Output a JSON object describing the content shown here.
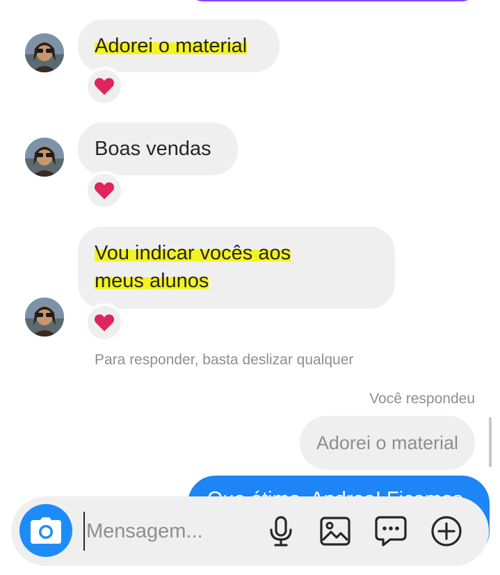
{
  "messages": [
    {
      "text": "Adorei o material",
      "reaction": "heart-icon"
    },
    {
      "text": "Boas vendas",
      "reaction": "heart-icon"
    },
    {
      "text_line1": "Vou indicar vocês aos",
      "text_line2": "meus alunos",
      "reaction": "heart-icon"
    }
  ],
  "hint": "Para responder, basta deslizar qualquer",
  "reply_label": "Você respondeu",
  "reply_quote": "Adorei o material",
  "outgoing_partial": "Que ótimo, Andrea! Ficamos",
  "composer": {
    "placeholder": "Mensagem...",
    "icons": [
      "camera-icon",
      "microphone-icon",
      "gallery-icon",
      "sticker-chat-icon",
      "add-icon"
    ]
  },
  "colors": {
    "highlight": "#f3f321",
    "outgoing_bubble": "#1d85f5",
    "camera_button": "#1d8cf8",
    "top_bubble": "#8a3ffc",
    "reaction_heart": "#e0245e"
  }
}
